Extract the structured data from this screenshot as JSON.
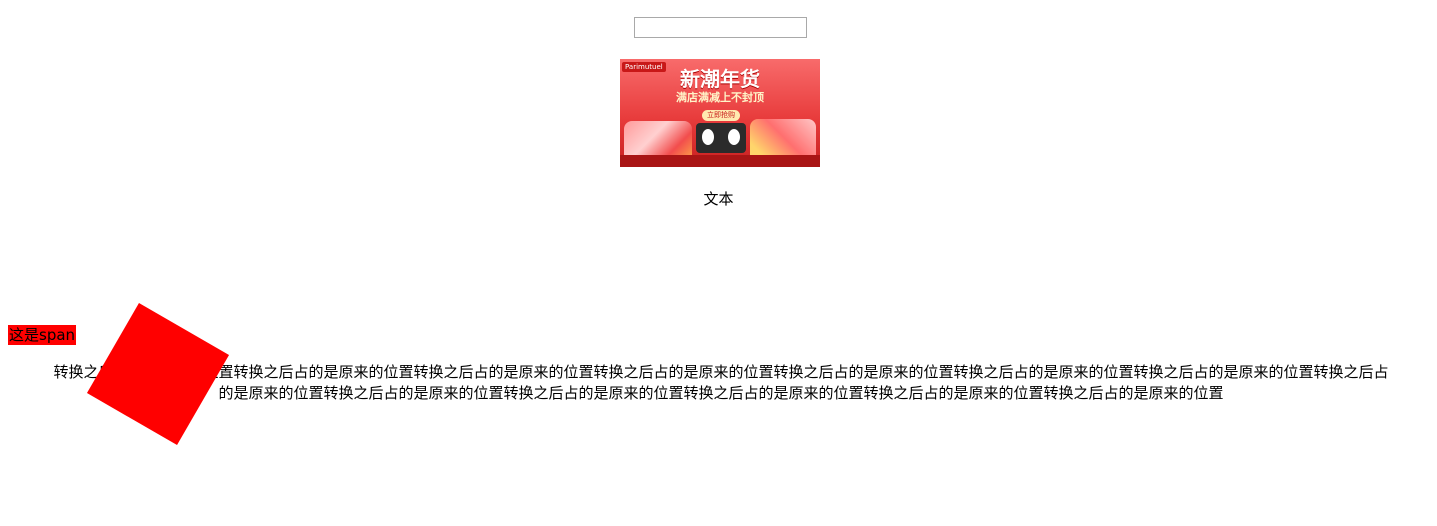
{
  "input": {
    "value": "",
    "placeholder": ""
  },
  "banner": {
    "badge": "Parimutuel",
    "headline": "新潮年货",
    "subheadline": "满店满减上不封顶",
    "pill": "立即抢购"
  },
  "center_text": "文本",
  "span_label": "这是span",
  "paragraph": {
    "line1": "转换之后占的是原来的位置转换之后占的是原来的位置转换之后占的是原来的位置转换之后占的是原来的位置转换之后占的是原来的位置转换之后占的是原来的位置转换之后占的是原来的位置转换之后占",
    "line2": "的是原来的位置转换之后占的是原来的位置转换之后占的是原来的位置转换之后占的是原来的位置转换之后占的是原来的位置转换之后占的是原来的位置"
  },
  "colors": {
    "accent": "#ff0000",
    "input_border": "#a9a9a9"
  }
}
